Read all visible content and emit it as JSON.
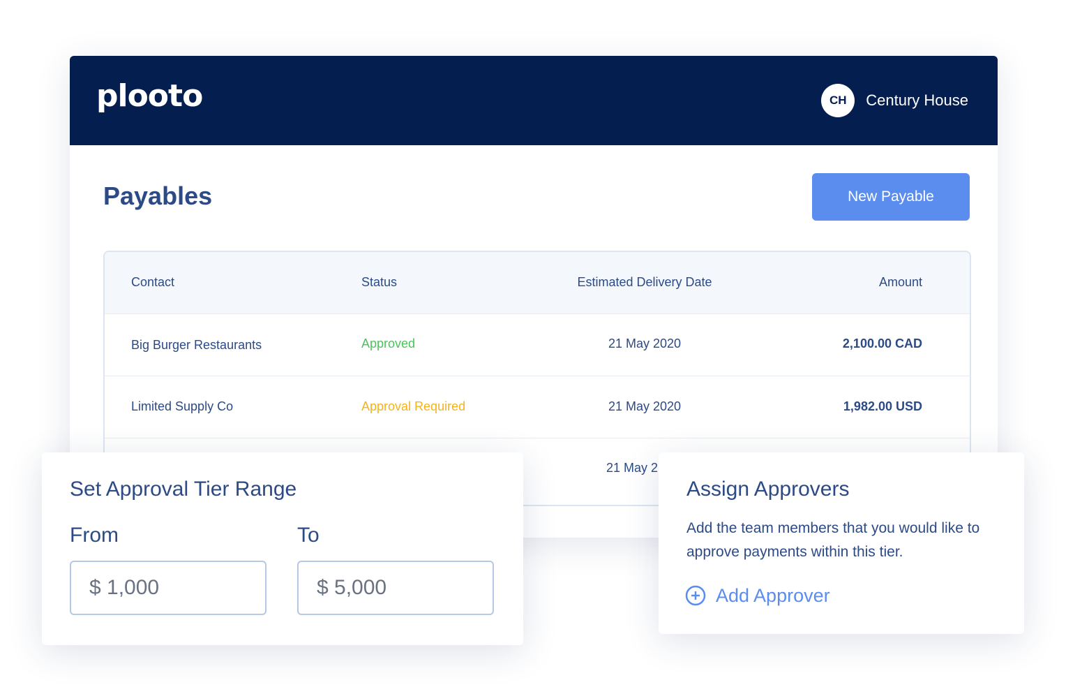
{
  "header": {
    "logo": "plooto",
    "avatar_initials": "CH",
    "account_name": "Century House"
  },
  "page": {
    "title": "Payables",
    "new_button": "New Payable"
  },
  "table": {
    "columns": [
      "Contact",
      "Status",
      "Estimated Delivery Date",
      "Amount"
    ],
    "rows": [
      {
        "contact": "Big Burger Restaurants",
        "status": "Approved",
        "date": "21 May 2020",
        "amount": "2,100.00 CAD"
      },
      {
        "contact": "Limited Supply Co",
        "status": "Approval Required",
        "date": "21 May 2020",
        "amount": "1,982.00 USD"
      },
      {
        "contact": "",
        "status": "",
        "date": "21 May 2",
        "amount": ""
      }
    ]
  },
  "tier_card": {
    "title": "Set Approval Tier Range",
    "from_label": "From",
    "to_label": "To",
    "from_value": "$ 1,000",
    "to_value": "$ 5,000"
  },
  "approvers_card": {
    "title": "Assign Approvers",
    "description": "Add the team members that you would like to approve payments within this tier.",
    "add_link": "Add Approver"
  },
  "colors": {
    "navy": "#031e4f",
    "text": "#2c4a86",
    "primary": "#5b8def",
    "approved": "#4cc25c",
    "approval_required": "#f5b31a"
  }
}
